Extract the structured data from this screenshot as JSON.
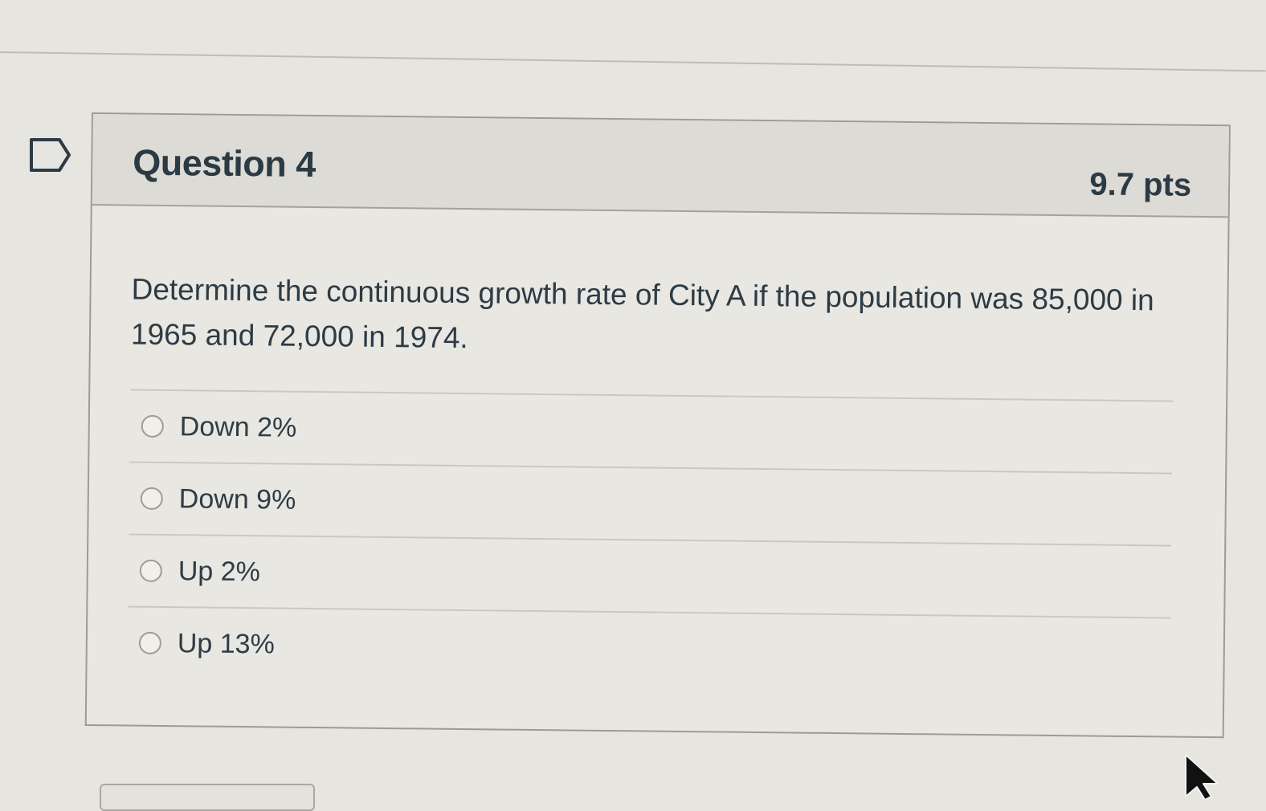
{
  "question": {
    "title": "Question 4",
    "points": "9.7 pts",
    "text": "Determine the continuous growth rate of City A if the population was 85,000 in 1965 and 72,000 in 1974.",
    "answers": [
      {
        "label": "Down 2%"
      },
      {
        "label": "Down 9%"
      },
      {
        "label": "Up 2%"
      },
      {
        "label": "Up 13%"
      }
    ]
  },
  "icons": {
    "flag": "flag-question-icon",
    "cursor": "mouse-pointer-icon"
  }
}
